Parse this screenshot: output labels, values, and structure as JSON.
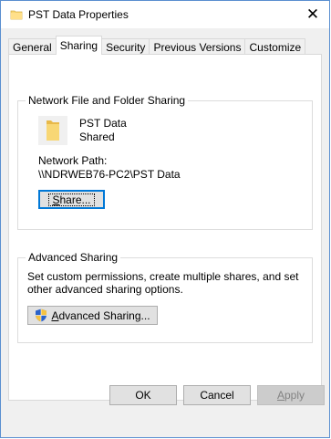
{
  "window": {
    "title": "PST Data Properties",
    "close_glyph": "✕"
  },
  "tabs": [
    {
      "label": "General",
      "active": false
    },
    {
      "label": "Sharing",
      "active": true
    },
    {
      "label": "Security",
      "active": false
    },
    {
      "label": "Previous Versions",
      "active": false
    },
    {
      "label": "Customize",
      "active": false
    }
  ],
  "network_sharing": {
    "legend": "Network File and Folder Sharing",
    "folder_name": "PST Data",
    "folder_status": "Shared",
    "network_path_label": "Network Path:",
    "network_path_value": "\\\\NDRWEB76-PC2\\PST Data",
    "share_button": {
      "accel": "S",
      "rest": "hare..."
    }
  },
  "advanced_sharing": {
    "legend": "Advanced Sharing",
    "description": "Set custom permissions, create multiple shares, and set other advanced sharing options.",
    "button": {
      "accel": "A",
      "rest": "dvanced Sharing..."
    }
  },
  "footer": {
    "ok_label": "OK",
    "cancel_label": "Cancel",
    "apply_accel": "A",
    "apply_rest": "pply"
  },
  "colors": {
    "folder_yellow": "#f8d775",
    "window_border": "#5a8fd0",
    "focus_blue": "#0078d7"
  }
}
